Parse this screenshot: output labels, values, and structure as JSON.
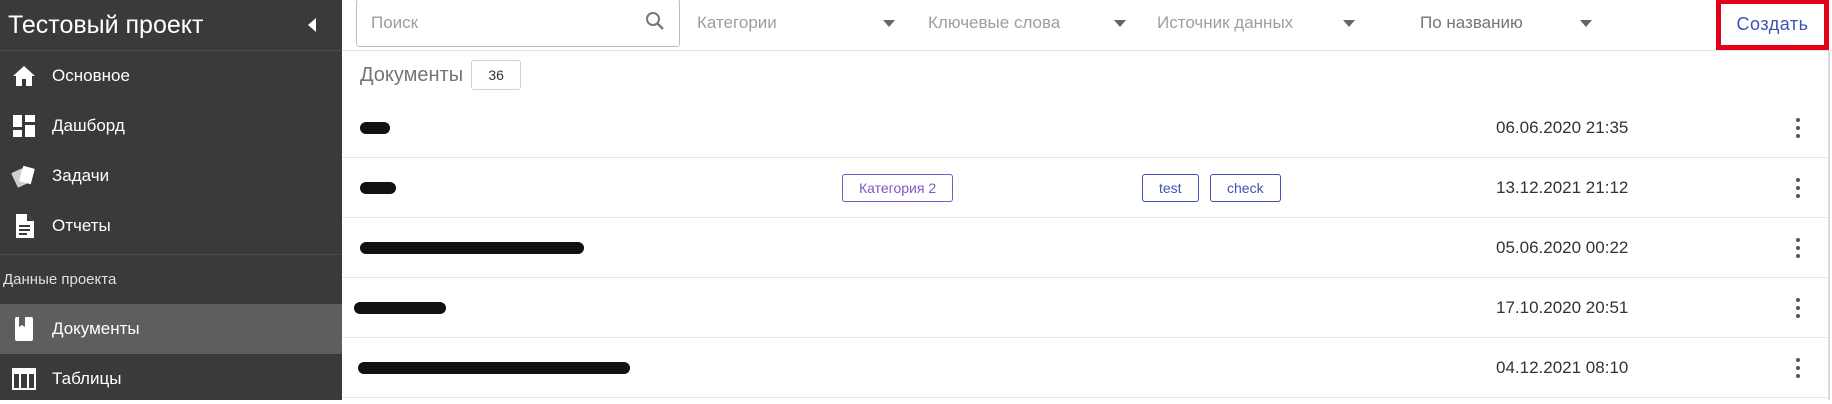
{
  "sidebar": {
    "project_title": "Тестовый проект",
    "items": [
      {
        "label": "Основное",
        "icon": "home-icon"
      },
      {
        "label": "Дашборд",
        "icon": "dashboard-icon"
      },
      {
        "label": "Задачи",
        "icon": "tasks-icon"
      },
      {
        "label": "Отчеты",
        "icon": "report-icon"
      }
    ],
    "section_label": "Данные проекта",
    "section_items": [
      {
        "label": "Документы",
        "icon": "book-icon",
        "active": true
      },
      {
        "label": "Таблицы",
        "icon": "table-icon"
      }
    ]
  },
  "toolbar": {
    "search_placeholder": "Поиск",
    "filters": [
      "Категории",
      "Ключевые слова",
      "Источник данных"
    ],
    "sort": "По названию",
    "create_label": "Создать"
  },
  "documents": {
    "heading": "Документы",
    "count": "36",
    "rows": [
      {
        "date": "06.06.2020 21:35",
        "category": "",
        "keywords": []
      },
      {
        "date": "13.12.2021 21:12",
        "category": "Категория 2",
        "keywords": [
          "test",
          "check"
        ]
      },
      {
        "date": "05.06.2020 00:22",
        "category": "",
        "keywords": []
      },
      {
        "date": "17.10.2020 20:51",
        "category": "",
        "keywords": []
      },
      {
        "date": "04.12.2021 08:10",
        "category": "",
        "keywords": []
      }
    ]
  },
  "colors": {
    "sidebar_bg": "#3a3a3c",
    "active_item_bg": "#5e5e61",
    "accent": "#3f51b5",
    "category_chip": "#7e57c2",
    "highlight_box": "#e3001b"
  }
}
